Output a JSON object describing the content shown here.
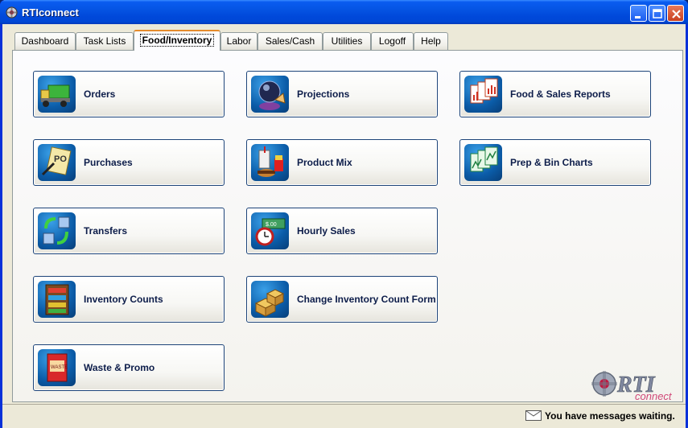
{
  "window": {
    "title": "RTIconnect"
  },
  "tabs": [
    {
      "label": "Dashboard"
    },
    {
      "label": "Task Lists"
    },
    {
      "label": "Food/Inventory"
    },
    {
      "label": "Labor"
    },
    {
      "label": "Sales/Cash"
    },
    {
      "label": "Utilities"
    },
    {
      "label": "Logoff"
    },
    {
      "label": "Help"
    }
  ],
  "active_tab": "Food/Inventory",
  "buttons": {
    "orders": {
      "label": "Orders",
      "icon": "delivery-truck-icon"
    },
    "projections": {
      "label": "Projections",
      "icon": "crystal-ball-icon"
    },
    "food_sales_reports": {
      "label": "Food & Sales Reports",
      "icon": "reports-icon"
    },
    "purchases": {
      "label": "Purchases",
      "icon": "purchase-order-icon"
    },
    "product_mix": {
      "label": "Product Mix",
      "icon": "fast-food-icon"
    },
    "prep_bin_charts": {
      "label": "Prep & Bin Charts",
      "icon": "charts-icon"
    },
    "transfers": {
      "label": "Transfers",
      "icon": "transfer-arrows-icon"
    },
    "hourly_sales": {
      "label": "Hourly Sales",
      "icon": "clock-icon"
    },
    "inventory_counts": {
      "label": "Inventory Counts",
      "icon": "shelves-icon"
    },
    "change_inventory_count_form": {
      "label": "Change Inventory Count Form",
      "icon": "boxes-icon"
    },
    "waste_promo": {
      "label": "Waste & Promo",
      "icon": "waste-bin-icon"
    }
  },
  "status": {
    "message": "You have messages waiting."
  },
  "logo": {
    "text": "RTI",
    "subtext": "connect"
  }
}
